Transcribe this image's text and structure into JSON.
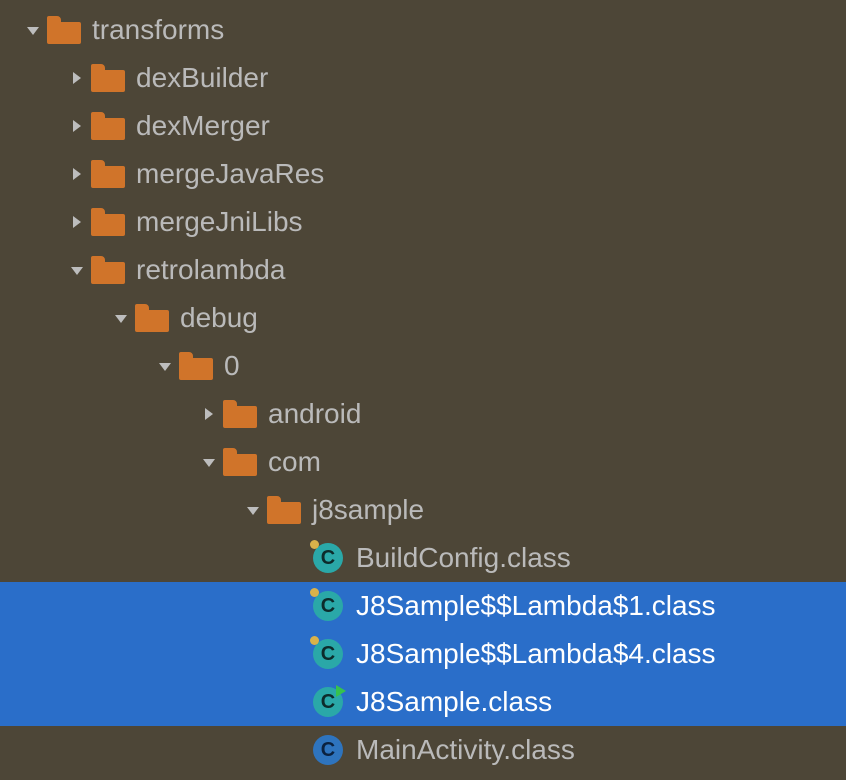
{
  "indentUnit": 44,
  "colors": {
    "folder": "#d0742a",
    "selection": "#2a6ec9",
    "iconTeal": "#2aa8a8",
    "iconBlue": "#2e74be",
    "background": "#4d4637",
    "text": "#bababa",
    "textSelected": "#ffffff"
  },
  "rows": [
    {
      "depth": 0,
      "arrow": "down",
      "icon": "folder",
      "label": "transforms",
      "selected": false
    },
    {
      "depth": 1,
      "arrow": "right",
      "icon": "folder",
      "label": "dexBuilder",
      "selected": false
    },
    {
      "depth": 1,
      "arrow": "right",
      "icon": "folder",
      "label": "dexMerger",
      "selected": false
    },
    {
      "depth": 1,
      "arrow": "right",
      "icon": "folder",
      "label": "mergeJavaRes",
      "selected": false
    },
    {
      "depth": 1,
      "arrow": "right",
      "icon": "folder",
      "label": "mergeJniLibs",
      "selected": false
    },
    {
      "depth": 1,
      "arrow": "down",
      "icon": "folder",
      "label": "retrolambda",
      "selected": false
    },
    {
      "depth": 2,
      "arrow": "down",
      "icon": "folder",
      "label": "debug",
      "selected": false
    },
    {
      "depth": 3,
      "arrow": "down",
      "icon": "folder",
      "label": "0",
      "selected": false
    },
    {
      "depth": 4,
      "arrow": "right",
      "icon": "folder",
      "label": "android",
      "selected": false
    },
    {
      "depth": 4,
      "arrow": "down",
      "icon": "folder",
      "label": "com",
      "selected": false
    },
    {
      "depth": 5,
      "arrow": "down",
      "icon": "folder",
      "label": "j8sample",
      "selected": false
    },
    {
      "depth": 6,
      "arrow": "none",
      "icon": "class-teal",
      "badge": "dot",
      "label": "BuildConfig.class",
      "selected": false
    },
    {
      "depth": 6,
      "arrow": "none",
      "icon": "class-teal",
      "badge": "dot",
      "label": "J8Sample$$Lambda$1.class",
      "selected": true
    },
    {
      "depth": 6,
      "arrow": "none",
      "icon": "class-teal",
      "badge": "dot",
      "label": "J8Sample$$Lambda$4.class",
      "selected": true
    },
    {
      "depth": 6,
      "arrow": "none",
      "icon": "class-teal",
      "badge": "run",
      "label": "J8Sample.class",
      "selected": true
    },
    {
      "depth": 6,
      "arrow": "none",
      "icon": "class-blue",
      "badge": "",
      "label": "MainActivity.class",
      "selected": false
    }
  ]
}
